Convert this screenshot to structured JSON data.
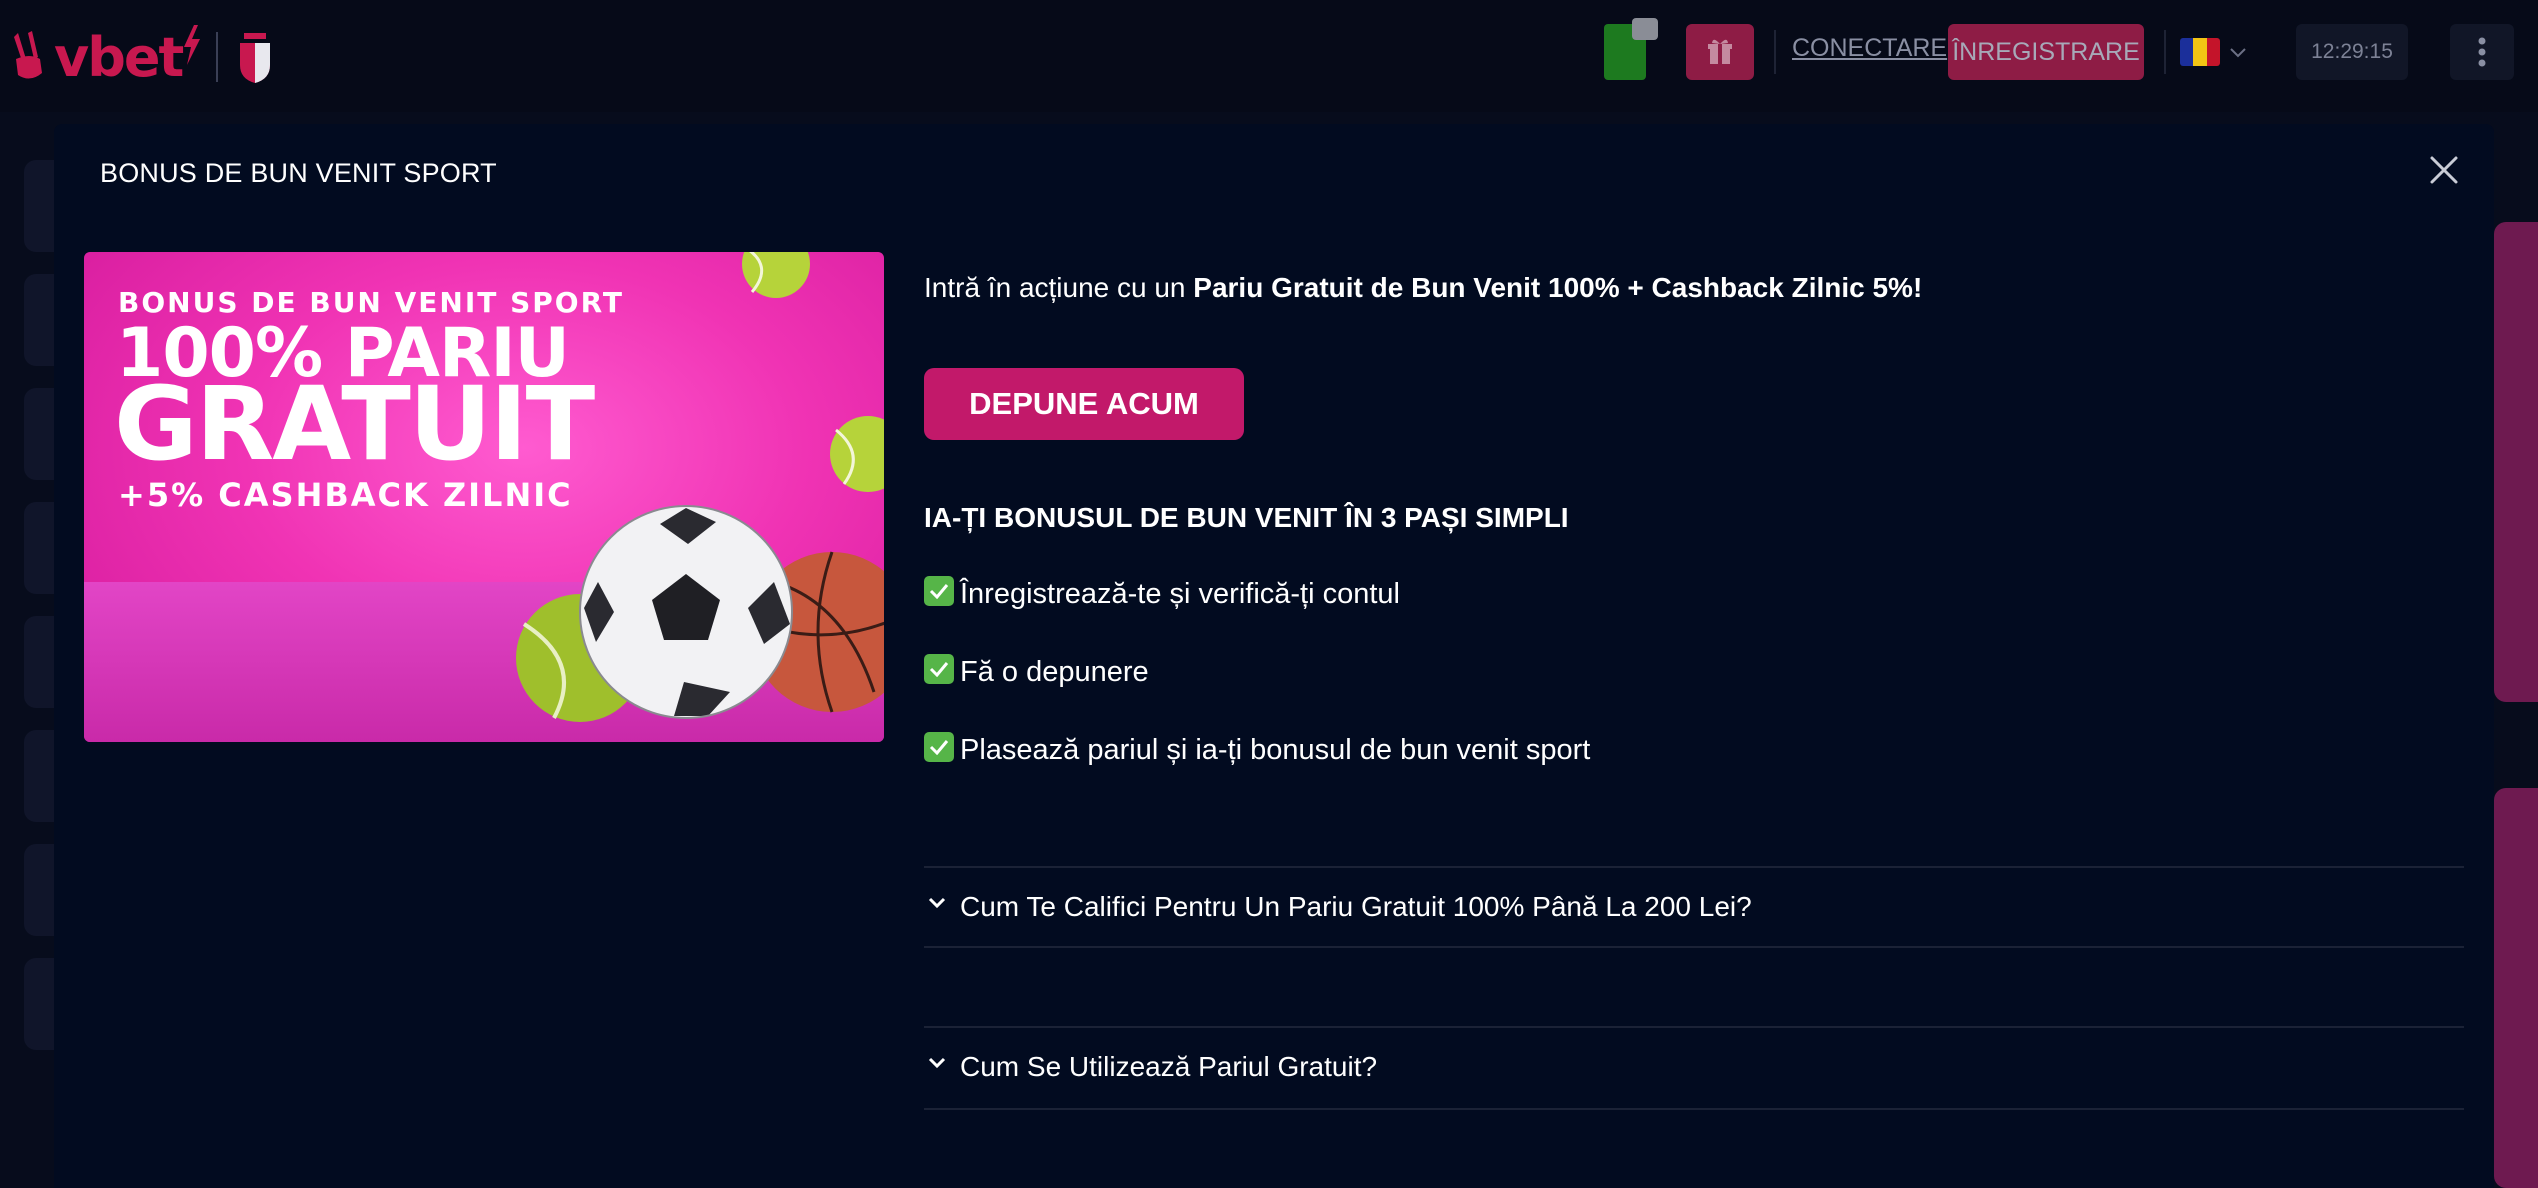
{
  "header": {
    "logo_text": "vbet",
    "login_label": "CONECTARE",
    "register_label": "ÎNREGISTRARE",
    "clock": "12:29:15",
    "language_flag": "Romania",
    "icons": [
      "wallet-icon",
      "gift-icon",
      "chevron-down-icon",
      "more-vertical-icon"
    ]
  },
  "modal": {
    "title": "BONUS DE BUN VENIT SPORT",
    "promo": {
      "line1": "BONUS DE BUN VENIT SPORT",
      "line2": "100% PARIU",
      "line3": "GRATUIT",
      "line4": "+5% CASHBACK ZILNIC"
    },
    "intro_prefix": "Intră în acțiune cu un ",
    "intro_bold": "Pariu Gratuit de Bun Venit 100% + Cashback Zilnic 5%!",
    "deposit_button": "DEPUNE ACUM",
    "steps_title": "IA-ȚI BONUSUL DE BUN VENIT ÎN 3 PAȘI SIMPLI",
    "steps": [
      "Înregistrează-te și verifică-ți contul",
      "Fă o depunere",
      "Plasează pariul și ia-ți bonusul de bun venit sport"
    ],
    "faq": [
      "Cum Te Califici Pentru Un Pariu Gratuit 100% Până La 200 Lei?",
      "Cum Se Utilizează Pariul Gratuit?"
    ]
  },
  "colors": {
    "brand": "#c8184f",
    "button": "#c2196a",
    "modal_bg": "#020b20",
    "check": "#56b548"
  }
}
